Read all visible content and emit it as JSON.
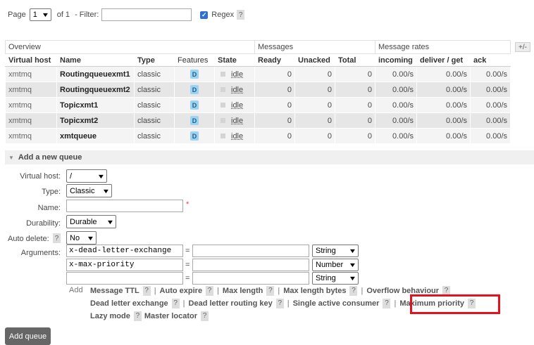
{
  "paging": {
    "page_label": "Page",
    "page_value": "1",
    "of_label": "of 1",
    "filter_label": "- Filter:",
    "filter_value": "",
    "regex_label": "Regex",
    "regex_checked": true,
    "help": "?"
  },
  "table": {
    "group_headers": [
      "Overview",
      "Messages",
      "Message rates"
    ],
    "toggle_columns": "+/-",
    "columns": [
      "Virtual host",
      "Name",
      "Type",
      "Features",
      "State",
      "Ready",
      "Unacked",
      "Total",
      "incoming",
      "deliver / get",
      "ack"
    ],
    "rows": [
      {
        "vhost": "xmtmq",
        "name": "Routingqueuexmt1",
        "type": "classic",
        "feature": "D",
        "state": "idle",
        "ready": "0",
        "unacked": "0",
        "total": "0",
        "incoming": "0.00/s",
        "deliver": "0.00/s",
        "ack": "0.00/s"
      },
      {
        "vhost": "xmtmq",
        "name": "Routingqueuexmt2",
        "type": "classic",
        "feature": "D",
        "state": "idle",
        "ready": "0",
        "unacked": "0",
        "total": "0",
        "incoming": "0.00/s",
        "deliver": "0.00/s",
        "ack": "0.00/s"
      },
      {
        "vhost": "xmtmq",
        "name": "Topicxmt1",
        "type": "classic",
        "feature": "D",
        "state": "idle",
        "ready": "0",
        "unacked": "0",
        "total": "0",
        "incoming": "0.00/s",
        "deliver": "0.00/s",
        "ack": "0.00/s"
      },
      {
        "vhost": "xmtmq",
        "name": "Topicxmt2",
        "type": "classic",
        "feature": "D",
        "state": "idle",
        "ready": "0",
        "unacked": "0",
        "total": "0",
        "incoming": "0.00/s",
        "deliver": "0.00/s",
        "ack": "0.00/s"
      },
      {
        "vhost": "xmtmq",
        "name": "xmtqueue",
        "type": "classic",
        "feature": "D",
        "state": "idle",
        "ready": "0",
        "unacked": "0",
        "total": "0",
        "incoming": "0.00/s",
        "deliver": "0.00/s",
        "ack": "0.00/s"
      }
    ]
  },
  "add_queue": {
    "title": "Add a new queue",
    "virtual_host_label": "Virtual host:",
    "virtual_host_value": "/",
    "type_label": "Type:",
    "type_value": "Classic",
    "name_label": "Name:",
    "name_value": "",
    "required_mark": "*",
    "durability_label": "Durability:",
    "durability_value": "Durable",
    "auto_delete_label": "Auto delete:",
    "auto_delete_value": "No",
    "arguments_label": "Arguments:",
    "equals": "=",
    "arguments": [
      {
        "key": "x-dead-letter-exchange",
        "value": "",
        "type": "String"
      },
      {
        "key": "x-max-priority",
        "value": "",
        "type": "Number"
      },
      {
        "key": "",
        "value": "",
        "type": "String"
      }
    ],
    "add_label": "Add",
    "arg_links": {
      "message_ttl": "Message TTL",
      "auto_expire": "Auto expire",
      "max_length": "Max length",
      "max_length_bytes": "Max length bytes",
      "overflow_behaviour": "Overflow behaviour",
      "dead_letter_exchange": "Dead letter exchange",
      "dead_letter_routing_key": "Dead letter routing key",
      "single_active_consumer": "Single active consumer",
      "maximum_priority": "Maximum priority",
      "lazy_mode": "Lazy mode",
      "master_locator": "Master locator"
    },
    "separator": "|",
    "submit_label": "Add queue"
  },
  "colors": {
    "highlight": "#e3131e",
    "feature_badge": "#9bd3f1",
    "button": "#666666"
  }
}
